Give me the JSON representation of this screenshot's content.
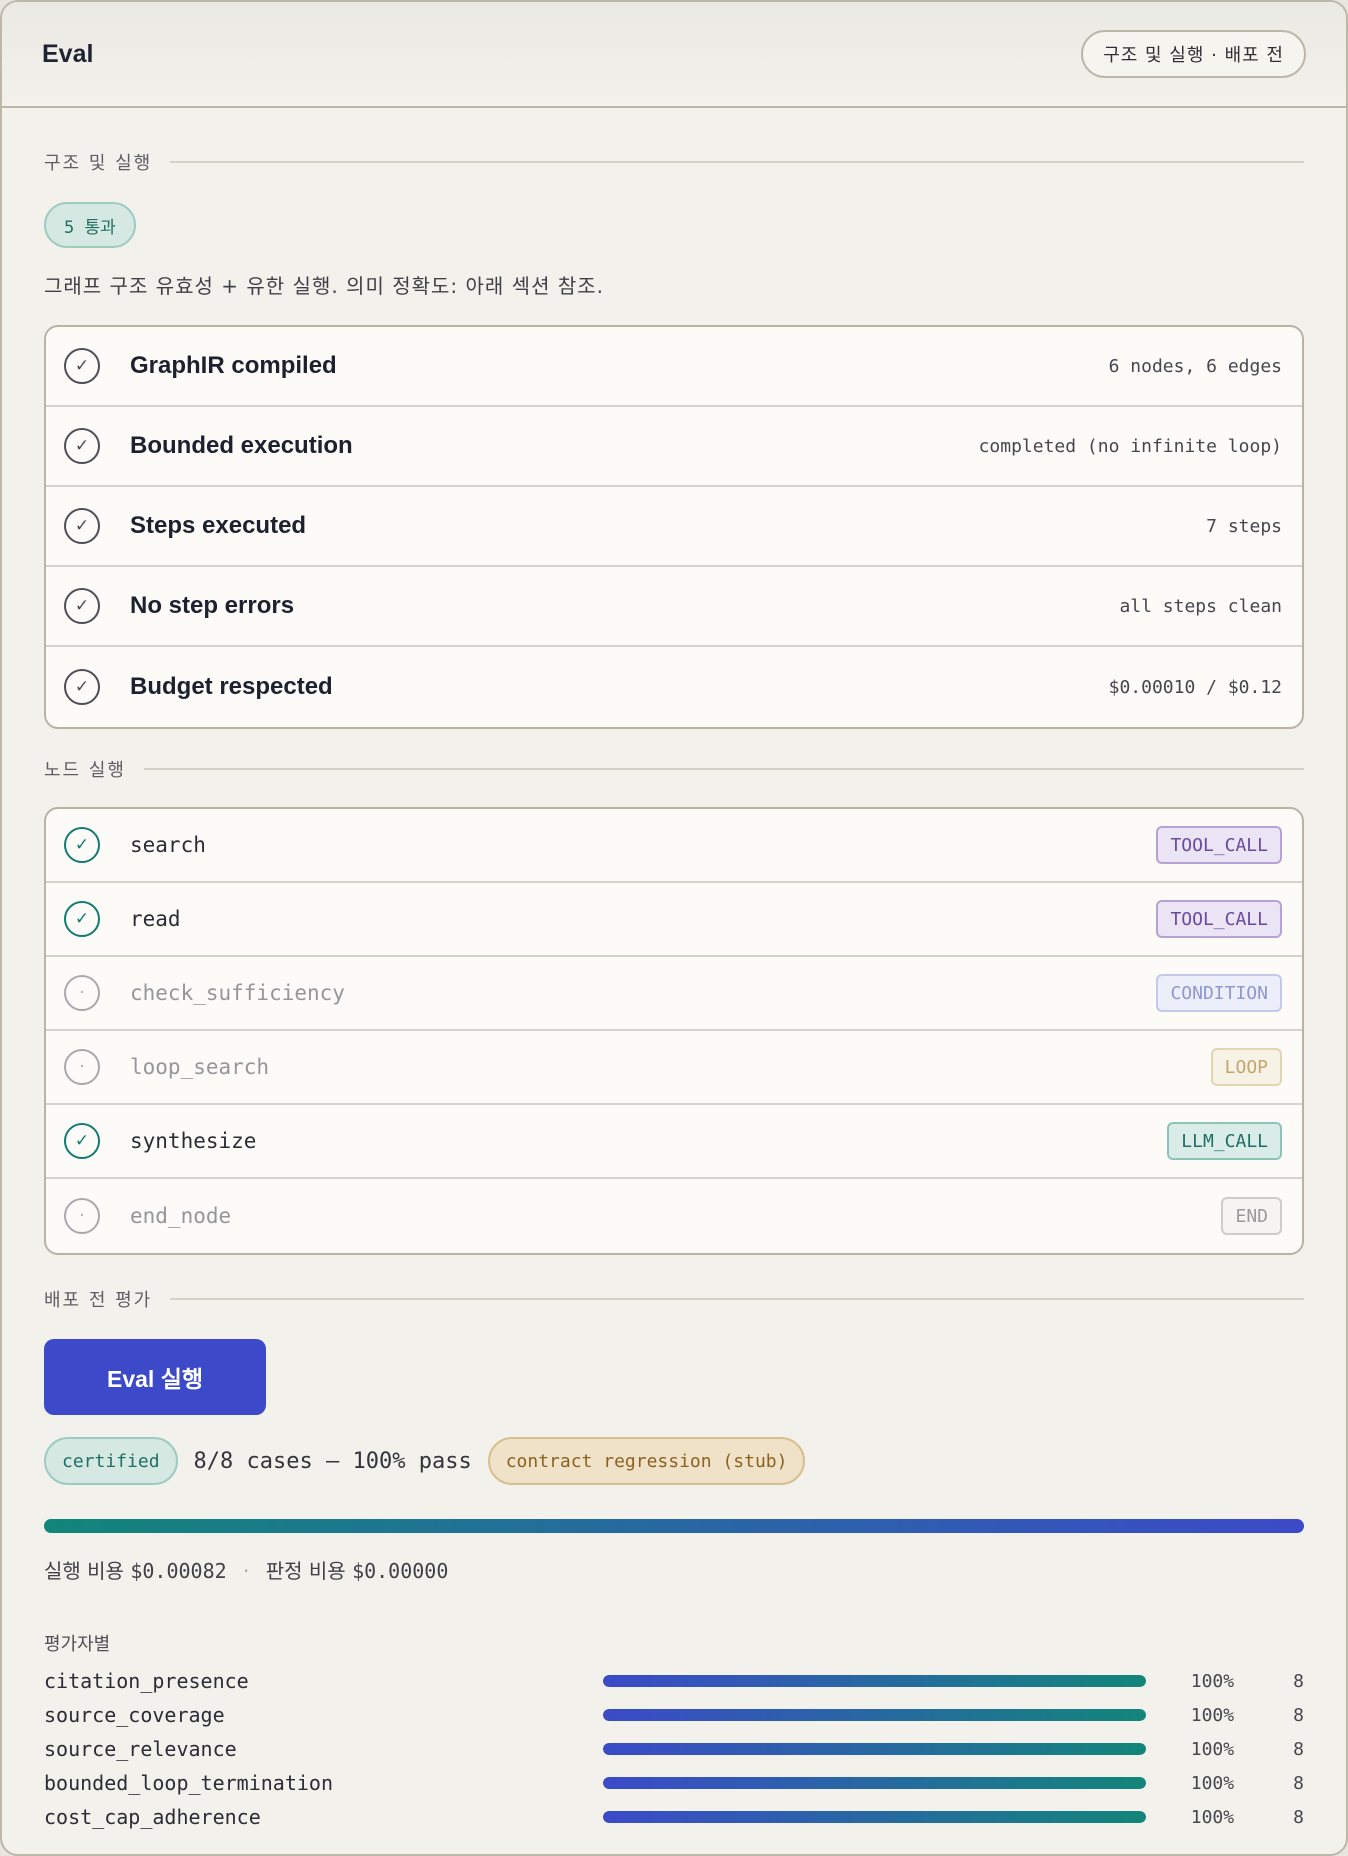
{
  "header": {
    "title": "Eval",
    "status_pill": "구조 및 실행 · 배포 전"
  },
  "structure": {
    "section_label": "구조 및 실행",
    "pass_badge": "5 통과",
    "description": "그래프 구조 유효성 + 유한 실행. 의미 정확도: 아래 섹션 참조.",
    "checks": [
      {
        "label": "GraphIR compiled",
        "value": "6 nodes, 6 edges",
        "icon": "check-icon"
      },
      {
        "label": "Bounded execution",
        "value": "completed (no infinite loop)",
        "icon": "check-icon"
      },
      {
        "label": "Steps executed",
        "value": "7 steps",
        "icon": "check-icon"
      },
      {
        "label": "No step errors",
        "value": "all steps clean",
        "icon": "check-icon"
      },
      {
        "label": "Budget respected",
        "value": "$0.00010 / $0.12",
        "icon": "check-icon"
      }
    ]
  },
  "nodes": {
    "section_label": "노드 실행",
    "items": [
      {
        "name": "search",
        "tag": "TOOL_CALL",
        "executed": true
      },
      {
        "name": "read",
        "tag": "TOOL_CALL",
        "executed": true
      },
      {
        "name": "check_sufficiency",
        "tag": "CONDITION",
        "executed": false
      },
      {
        "name": "loop_search",
        "tag": "LOOP",
        "executed": false
      },
      {
        "name": "synthesize",
        "tag": "LLM_CALL",
        "executed": true
      },
      {
        "name": "end_node",
        "tag": "END",
        "executed": false
      }
    ]
  },
  "predeploy": {
    "section_label": "배포 전 평가",
    "run_button": "Eval 실행",
    "certified": "certified",
    "cases_summary": "8/8 cases — 100% pass",
    "stub_chip": "contract regression (stub)",
    "overall_pass_fraction": 1.0,
    "cost": {
      "run_label": "실행 비용",
      "run_value": "$0.00082",
      "judge_label": "판정 비용",
      "judge_value": "$0.00000"
    },
    "per_evaluator_title": "평가자별",
    "evaluators": [
      {
        "name": "citation_presence",
        "pct": "100%",
        "n": "8",
        "fraction": 1.0
      },
      {
        "name": "source_coverage",
        "pct": "100%",
        "n": "8",
        "fraction": 1.0
      },
      {
        "name": "source_relevance",
        "pct": "100%",
        "n": "8",
        "fraction": 1.0
      },
      {
        "name": "bounded_loop_termination",
        "pct": "100%",
        "n": "8",
        "fraction": 1.0
      },
      {
        "name": "cost_cap_adherence",
        "pct": "100%",
        "n": "8",
        "fraction": 1.0
      }
    ]
  }
}
